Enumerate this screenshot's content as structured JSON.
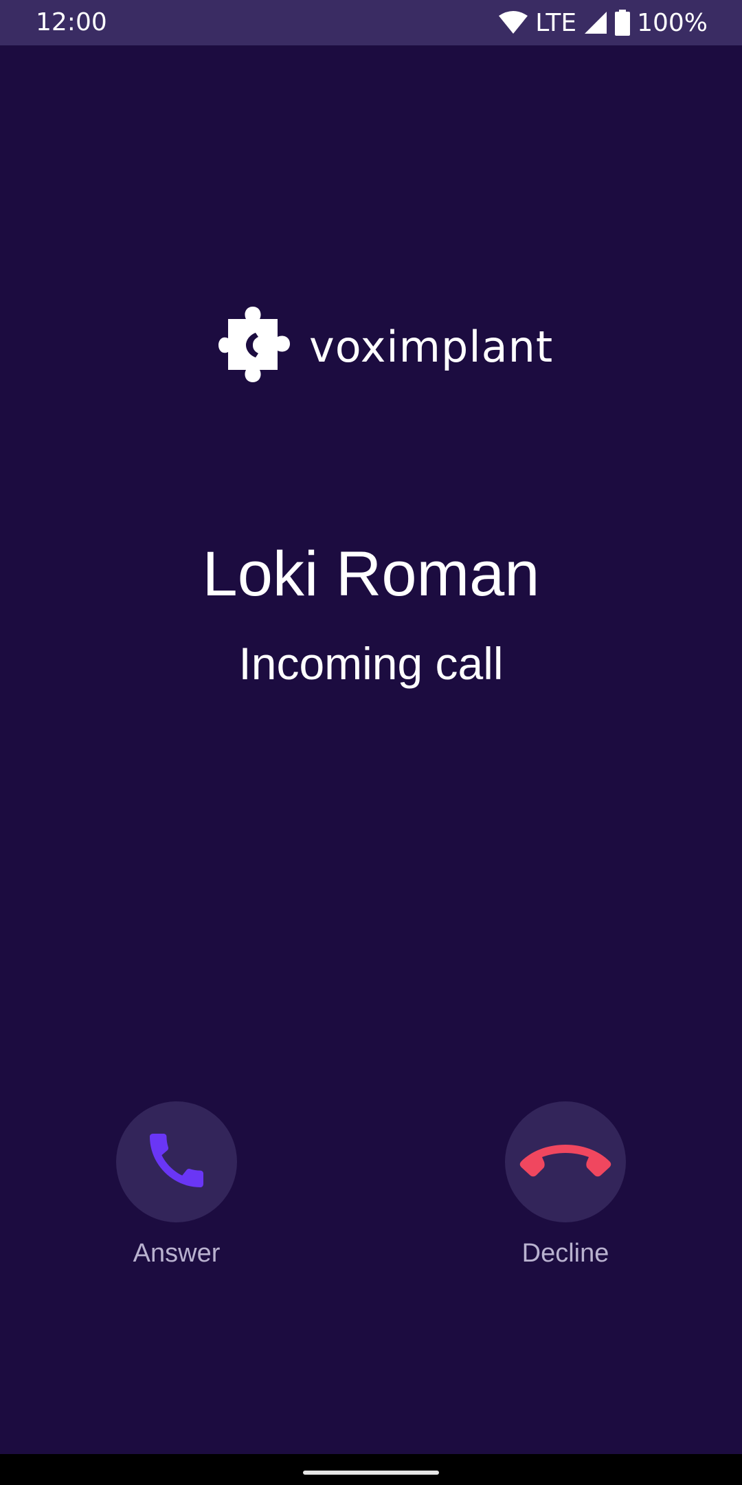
{
  "status_bar": {
    "time": "12:00",
    "network": "LTE",
    "battery": "100%",
    "icons": [
      "wifi-icon",
      "signal-icon",
      "battery-icon"
    ]
  },
  "logo": {
    "text": "voximplant",
    "icon": "puzzle-phone-logo-icon"
  },
  "call": {
    "caller_name": "Loki Roman",
    "status": "Incoming call"
  },
  "actions": {
    "answer": {
      "label": "Answer",
      "icon": "phone-answer-icon",
      "color": "#6a36f5"
    },
    "decline": {
      "label": "Decline",
      "icon": "phone-hangup-icon",
      "color": "#f0475f"
    }
  },
  "colors": {
    "background": "#1c0c40",
    "status_bar": "#3a2c63",
    "button_bg": "#33255a",
    "label": "#b9b2cf"
  }
}
